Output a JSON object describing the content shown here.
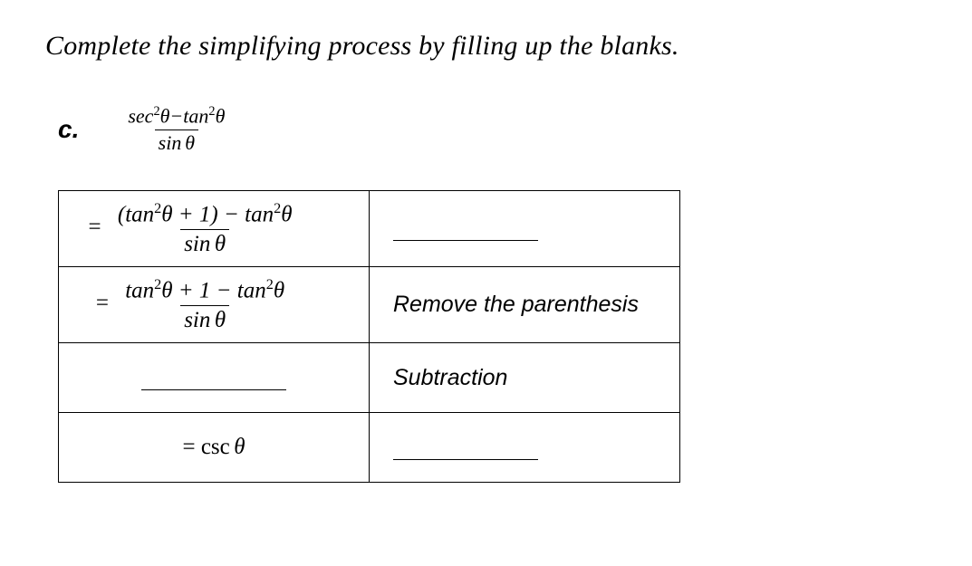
{
  "instruction": "Complete the simplifying process by filling up the blanks.",
  "problem": {
    "label": "c."
  },
  "expr": {
    "sec": "sec",
    "tan": "tan",
    "sin": "sin",
    "csc": "csc",
    "theta": "θ",
    "sq": "2",
    "minus": "−",
    "plus": "+",
    "one": "1",
    "eq": "=",
    "lpar": "(",
    "rpar": ")"
  },
  "reasons": {
    "r1_blank": "",
    "r2": "Remove the parenthesis",
    "r3": "Subtraction",
    "r4_blank": ""
  }
}
